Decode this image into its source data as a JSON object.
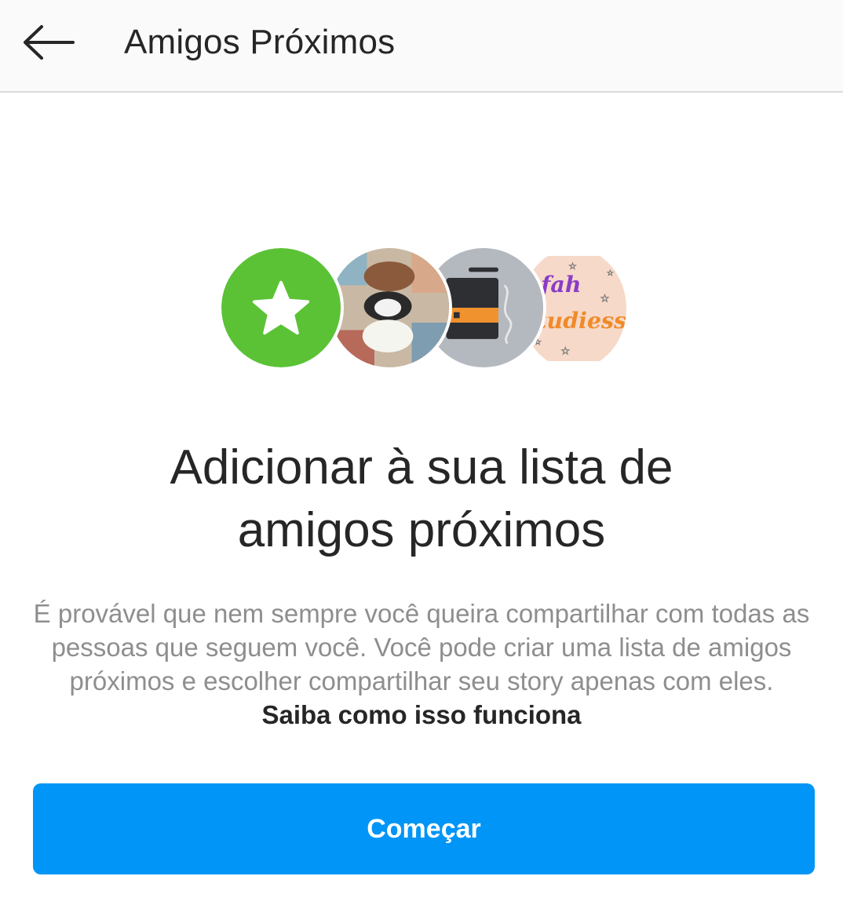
{
  "header": {
    "back_icon": "arrow-left-icon",
    "title": "Amigos Próximos"
  },
  "avatars": [
    {
      "name": "close-friends-star-icon",
      "color": "#5bc236"
    },
    {
      "name": "avatar-bears",
      "color": "#b9a58f"
    },
    {
      "name": "avatar-notebook",
      "color": "#b4b8bf"
    },
    {
      "name": "avatar-studies",
      "color": "#f6d9c8",
      "text_line1": "fah",
      "text_line2": "studiess"
    }
  ],
  "headline": {
    "line1": "Adicionar à sua lista de",
    "line2": "amigos próximos"
  },
  "description": {
    "text": "É provável que nem sempre você queira compartilhar com todas as pessoas que seguem você. Você pode criar uma lista de amigos próximos e escolher compartilhar seu story apenas com eles.",
    "link": "Saiba como isso funciona"
  },
  "cta": {
    "label": "Começar",
    "color": "#0095f6"
  }
}
